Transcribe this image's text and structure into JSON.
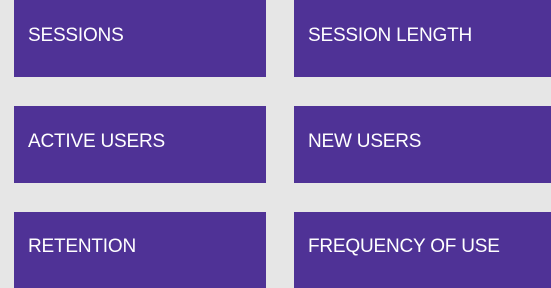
{
  "tiles": [
    {
      "label": "SESSIONS"
    },
    {
      "label": "SESSION LENGTH"
    },
    {
      "label": "ACTIVE USERS"
    },
    {
      "label": "NEW USERS"
    },
    {
      "label": "RETENTION"
    },
    {
      "label": "FREQUENCY OF USE"
    }
  ],
  "colors": {
    "background": "#e6e6e6",
    "tile": "#4f3296",
    "tile_text": "#ffffff"
  }
}
